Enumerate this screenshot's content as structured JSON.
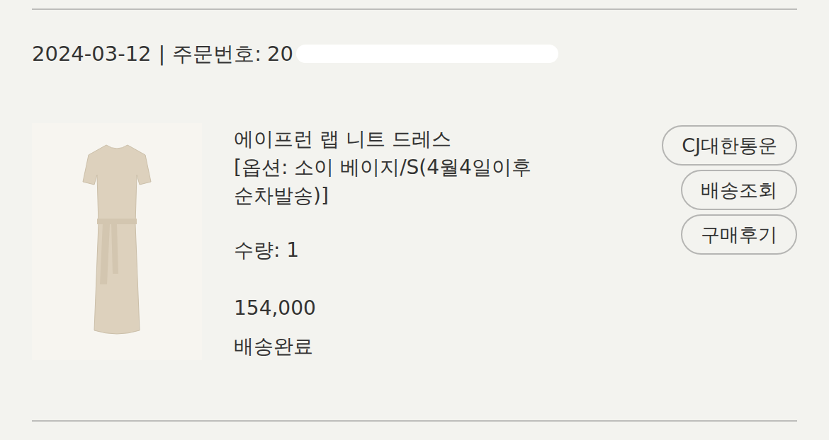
{
  "order": {
    "date": "2024-03-12",
    "separator": "|",
    "order_label": "주문번호:",
    "order_number": "20"
  },
  "item": {
    "name": "에이프런 랩 니트 드레스",
    "option": "[옵션: 소이 베이지/S(4월4일이후 순차발송)]",
    "quantity": "수량: 1",
    "price": "154,000",
    "status": "배송완료"
  },
  "buttons": [
    {
      "label": "CJ대한통운"
    },
    {
      "label": "배송조회"
    },
    {
      "label": "구매후기"
    }
  ]
}
